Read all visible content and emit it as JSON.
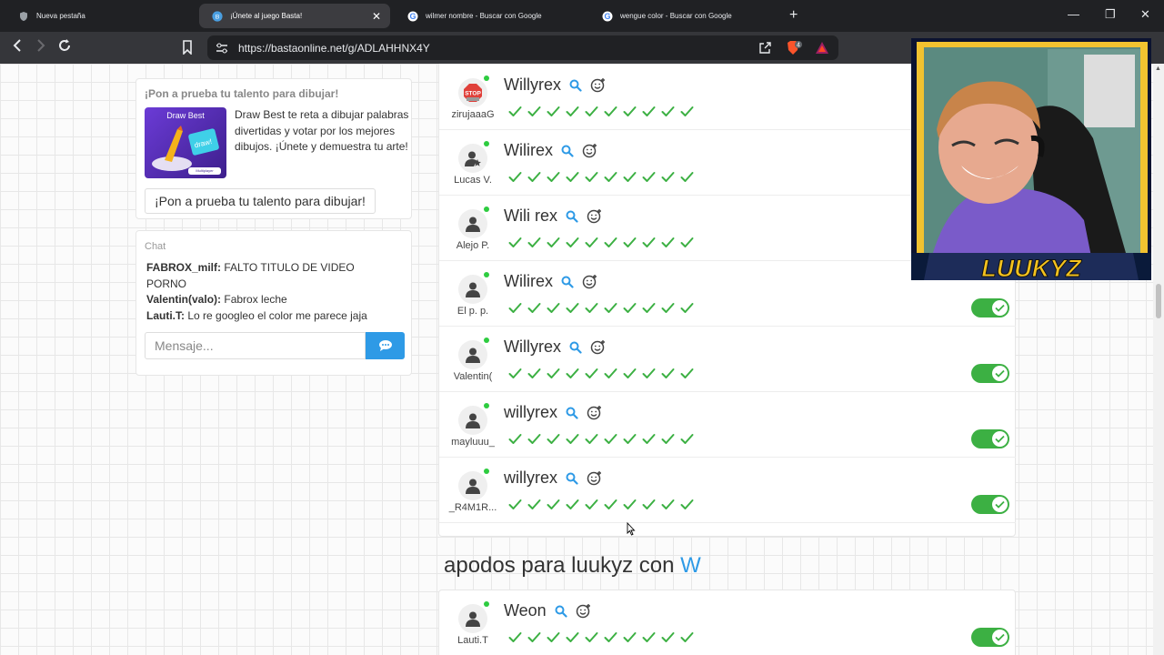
{
  "browser": {
    "tabs": [
      {
        "title": "Nueva pestaña",
        "icon": "shield-icon"
      },
      {
        "title": "¡Únete al juego Basta!",
        "icon": "basta-icon",
        "active": true
      },
      {
        "title": "wilmer nombre - Buscar con Google",
        "icon": "google-icon"
      },
      {
        "title": "wengue color - Buscar con Google",
        "icon": "google-icon"
      }
    ],
    "url": "https://bastaonline.net/g/ADLAHHNX4Y",
    "brave_badge": "4"
  },
  "promo": {
    "title": "¡Pon a prueba tu talento para dibujar!",
    "image_title": "Draw Best",
    "image_tag": "Multiplayer",
    "description": "Draw Best te reta a dibujar palabras divertidas y votar por los mejores dibujos. ¡Únete y demuestra tu arte!",
    "button_label": "¡Pon a prueba tu talento para dibujar!"
  },
  "chat": {
    "title": "Chat",
    "messages": [
      {
        "user": "FABROX_milf:",
        "text": "FALTO TITULO DE VIDEO PORNO"
      },
      {
        "user": "Valentin(valo):",
        "text": "Fabrox leche"
      },
      {
        "user": "Lauti.T:",
        "text": "Lo re googleo el color me parece jaja"
      }
    ],
    "placeholder": "Mensaje..."
  },
  "answers": [
    {
      "word": "Willyrex",
      "user": "zirujaaaG",
      "avatar": "stop-icon",
      "votes": 10,
      "toggle": null
    },
    {
      "word": "Wilirex",
      "user": "Lucas V.",
      "avatar": "user-star-icon",
      "votes": 10,
      "toggle": null
    },
    {
      "word": "Wili rex",
      "user": "Alejo P.",
      "avatar": "user-icon",
      "votes": 10,
      "toggle": null
    },
    {
      "word": "Wilirex",
      "user": "El p. p.",
      "avatar": "user-icon",
      "votes": 10,
      "toggle": "on"
    },
    {
      "word": "Willyrex",
      "user": "Valentin(",
      "avatar": "user-icon",
      "votes": 10,
      "toggle": "on"
    },
    {
      "word": "willyrex",
      "user": "mayluuu_",
      "avatar": "user-icon",
      "votes": 10,
      "toggle": "on"
    },
    {
      "word": "willyrex",
      "user": "_R4M1R...",
      "avatar": "user-icon",
      "votes": 10,
      "toggle": "on"
    }
  ],
  "section": {
    "heading": "apodos para luukyz con",
    "letter": "W"
  },
  "section_answers": [
    {
      "word": "Weon",
      "user": "Lauti.T",
      "avatar": "user-icon",
      "votes": 10,
      "toggle": "on"
    }
  ],
  "webcam": {
    "overlay_text": "LUUKYZ"
  },
  "colors": {
    "accent": "#2e9ae6",
    "toggle_on": "#3cb043",
    "check": "#3cb043",
    "online": "#2ecc40"
  }
}
